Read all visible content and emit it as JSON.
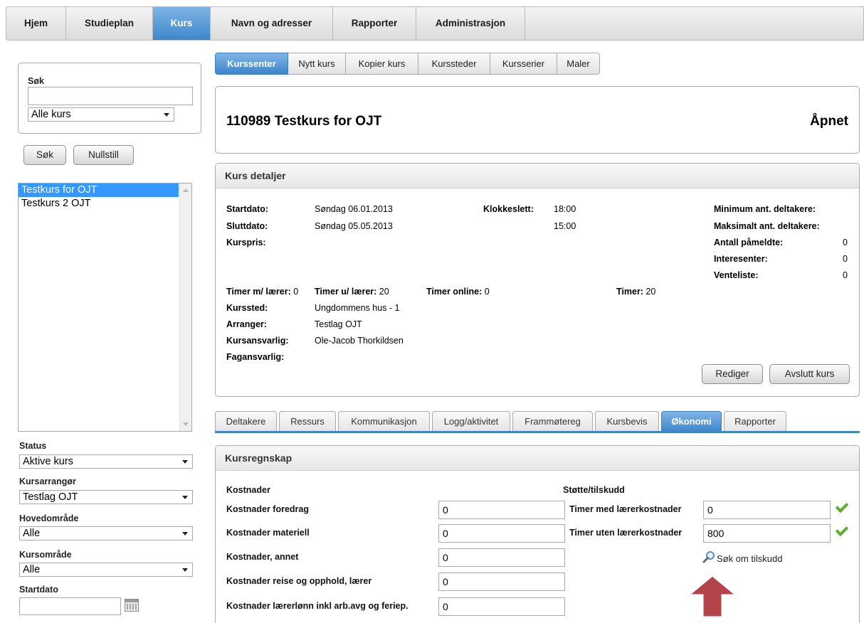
{
  "topnav": [
    {
      "label": "Hjem",
      "active": false
    },
    {
      "label": "Studieplan",
      "active": false
    },
    {
      "label": "Kurs",
      "active": true
    },
    {
      "label": "Navn og adresser",
      "active": false
    },
    {
      "label": "Rapporter",
      "active": false
    },
    {
      "label": "Administrasjon",
      "active": false
    }
  ],
  "sidebar": {
    "search_label": "Søk",
    "search_value": "",
    "scope_select": "Alle kurs",
    "search_button": "Søk",
    "reset_button": "Nullstill",
    "courses": [
      {
        "label": "Testkurs for OJT",
        "selected": true
      },
      {
        "label": "Testkurs 2 OJT",
        "selected": false
      }
    ],
    "filters": {
      "status_label": "Status",
      "status_value": "Aktive kurs",
      "arranger_label": "Kursarrangør",
      "arranger_value": "Testlag OJT",
      "main_area_label": "Hovedområde",
      "main_area_value": "Alle",
      "course_area_label": "Kursområde",
      "course_area_value": "Alle",
      "startdate_label": "Startdato",
      "startdate_value": ""
    }
  },
  "subtabs": [
    {
      "label": "Kurssenter",
      "active": true
    },
    {
      "label": "Nytt kurs",
      "active": false
    },
    {
      "label": "Kopier kurs",
      "active": false
    },
    {
      "label": "Kurssteder",
      "active": false
    },
    {
      "label": "Kursserier",
      "active": false
    },
    {
      "label": "Maler",
      "active": false
    }
  ],
  "course": {
    "title": "110989 Testkurs for OJT",
    "status": "Åpnet"
  },
  "details": {
    "heading": "Kurs detaljer",
    "startdato_label": "Startdato:",
    "startdato_value": "Søndag 06.01.2013",
    "sluttdato_label": "Sluttdato:",
    "sluttdato_value": "Søndag 05.05.2013",
    "kurspris_label": "Kurspris:",
    "klokkeslett_label": "Klokkeslett:",
    "klokkeslett_start": "18:00",
    "klokkeslett_end": "15:00",
    "min_label": "Minimum ant. deltakere:",
    "max_label": "Maksimalt ant. deltakere:",
    "pameldte_label": "Antall påmeldte:",
    "pameldte_value": "0",
    "interesenter_label": "Interesenter:",
    "interesenter_value": "0",
    "venteliste_label": "Venteliste:",
    "venteliste_value": "0",
    "timer_m_label": "Timer m/ lærer:",
    "timer_m_value": "0",
    "timer_u_label": "Timer u/ lærer:",
    "timer_u_value": "20",
    "timer_online_label": "Timer online:",
    "timer_online_value": "0",
    "timer_label": "Timer:",
    "timer_value": "20",
    "kurssted_label": "Kurssted:",
    "kurssted_value": "Ungdommens hus - 1",
    "arranger_label": "Arranger:",
    "arranger_value": "Testlag OJT",
    "kursansvarlig_label": "Kursansvarlig:",
    "kursansvarlig_value": "Ole-Jacob Thorkildsen",
    "fagansvarlig_label": "Fagansvarlig:",
    "edit_button": "Rediger",
    "close_button": "Avslutt kurs"
  },
  "lowtabs": [
    {
      "label": "Deltakere",
      "active": false
    },
    {
      "label": "Ressurs",
      "active": false
    },
    {
      "label": "Kommunikasjon",
      "active": false
    },
    {
      "label": "Logg/aktivitet",
      "active": false
    },
    {
      "label": "Frammøtereg",
      "active": false
    },
    {
      "label": "Kursbevis",
      "active": false
    },
    {
      "label": "Økonomi",
      "active": true
    },
    {
      "label": "Rapporter",
      "active": false
    }
  ],
  "finance": {
    "heading": "Kursregnskap",
    "costs_heading": "Kostnader",
    "costs": [
      {
        "label": "Kostnader foredrag",
        "value": "0"
      },
      {
        "label": "Kostnader materiell",
        "value": "0"
      },
      {
        "label": "Kostnader, annet",
        "value": "0"
      },
      {
        "label": "Kostnader reise og opphold, lærer",
        "value": "0"
      },
      {
        "label": "Kostnader lærerlønn inkl arb.avg og feriep.",
        "value": "0"
      }
    ],
    "support_heading": "Støtte/tilskudd",
    "support": [
      {
        "label": "Timer med lærerkostnader",
        "value": "0"
      },
      {
        "label": "Timer uten lærerkostnader",
        "value": "800"
      }
    ],
    "apply_link": "Søk om tilskudd"
  },
  "colors": {
    "accent": "#3d86cc",
    "check": "#5bb02d",
    "arrow": "#b5434a"
  }
}
